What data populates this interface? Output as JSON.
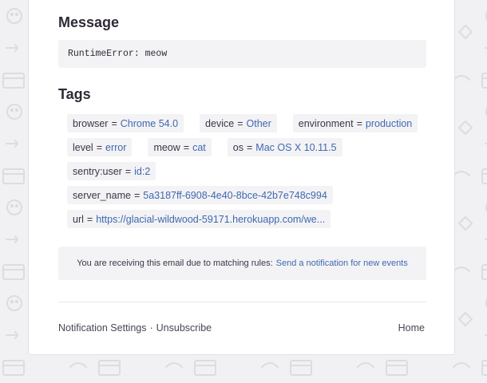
{
  "message": {
    "title": "Message",
    "text": "RuntimeError: meow"
  },
  "tags": {
    "title": "Tags",
    "rows": [
      [
        {
          "key": "browser",
          "value": "Chrome 54.0"
        },
        {
          "key": "device",
          "value": "Other"
        },
        {
          "key": "environment",
          "value": "production"
        }
      ],
      [
        {
          "key": "level",
          "value": "error"
        },
        {
          "key": "meow",
          "value": "cat"
        },
        {
          "key": "os",
          "value": "Mac OS X 10.11.5"
        }
      ],
      [
        {
          "key": "sentry:user",
          "value": "id:2"
        }
      ],
      [
        {
          "key": "server_name",
          "value": "5a3187ff-6908-4e40-8bce-42b7e748c994"
        }
      ],
      [
        {
          "key": "url",
          "value": "https://glacial-wildwood-59171.herokuapp.com/we..."
        }
      ]
    ]
  },
  "notice": {
    "text": "You are receiving this email due to matching rules:",
    "link": "Send a notification for new events"
  },
  "footer": {
    "settings": "Notification Settings",
    "separator": "·",
    "unsubscribe": "Unsubscribe",
    "home": "Home"
  }
}
